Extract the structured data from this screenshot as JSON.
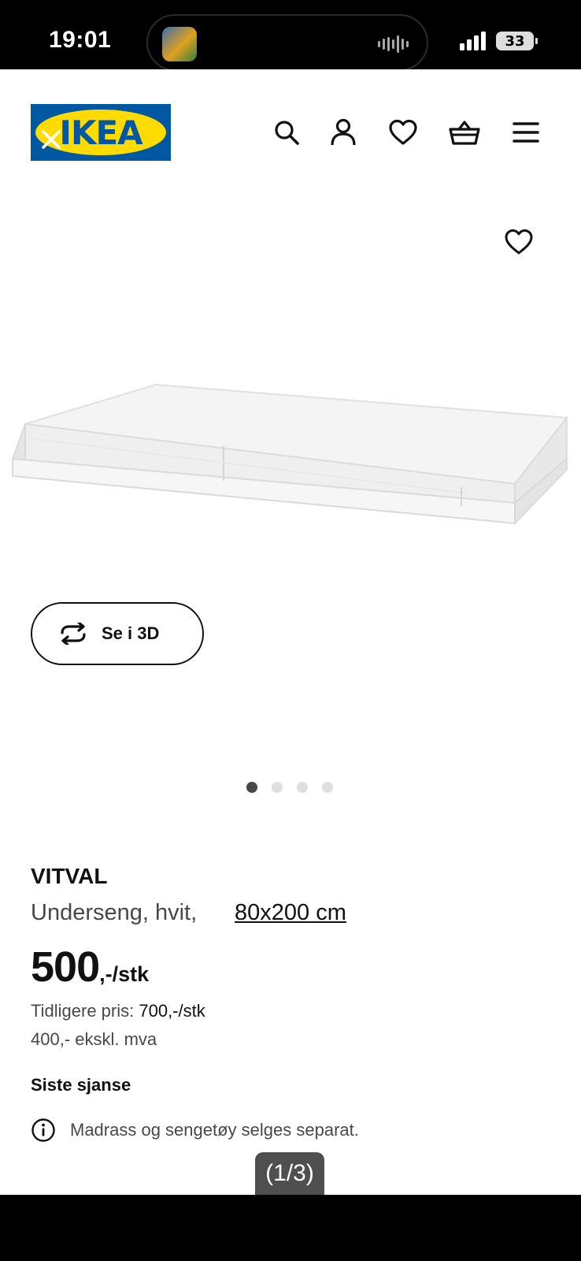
{
  "status_bar": {
    "time": "19:01",
    "battery": "33",
    "app_icon": "game-app-icon",
    "wave_icon": "audio-wave-icon",
    "signal_icon": "cellular-signal-icon"
  },
  "header": {
    "logo_text": "IKEA",
    "brand_colors": {
      "blue": "#0058a3",
      "yellow": "#ffdb00"
    },
    "icons": [
      "search-icon",
      "user-icon",
      "heart-icon",
      "basket-icon",
      "menu-icon"
    ]
  },
  "gallery": {
    "view_3d_label": "Se i 3D",
    "dots_count": 4,
    "active_dot": 1
  },
  "product": {
    "name": "VITVAL",
    "description": "Underseng, hvit,",
    "size": "80x200 cm",
    "price": "500",
    "price_suffix": ",-/stk",
    "previous_price_label": "Tidligere pris:",
    "previous_price_value": "700,-/stk",
    "ex_vat": "400,- ekskl. mva",
    "last_chance": "Siste sjanse",
    "info": "Madrass og sengetøy selges separat."
  },
  "viewer": {
    "counter": "(1/3)"
  }
}
